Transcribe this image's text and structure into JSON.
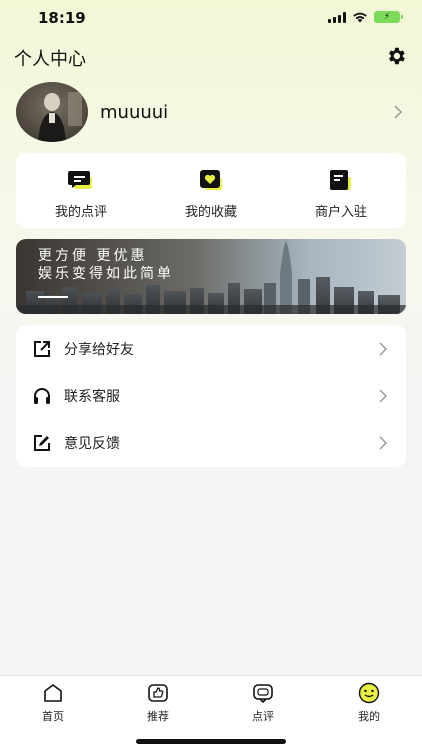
{
  "status_bar": {
    "time": "18:19"
  },
  "header": {
    "title": "个人中心"
  },
  "profile": {
    "username": "muuuui"
  },
  "quick_actions": [
    {
      "label": "我的点评",
      "icon": "review-chat-icon"
    },
    {
      "label": "我的收藏",
      "icon": "heart-favorites-icon"
    },
    {
      "label": "商户入驻",
      "icon": "merchant-doc-icon"
    }
  ],
  "banner": {
    "line1": "更方便 更优惠",
    "line2": "娱乐变得如此简单"
  },
  "menu": [
    {
      "label": "分享给好友",
      "icon": "share-icon"
    },
    {
      "label": "联系客服",
      "icon": "headset-icon"
    },
    {
      "label": "意见反馈",
      "icon": "feedback-edit-icon"
    }
  ],
  "tabs": [
    {
      "label": "首页",
      "icon": "home-icon"
    },
    {
      "label": "推荐",
      "icon": "thumbs-up-icon"
    },
    {
      "label": "点评",
      "icon": "comment-icon"
    },
    {
      "label": "我的",
      "icon": "smiley-icon",
      "active": true
    }
  ],
  "colors": {
    "accent": "#e8f046",
    "text": "#222222",
    "card": "#ffffff"
  }
}
